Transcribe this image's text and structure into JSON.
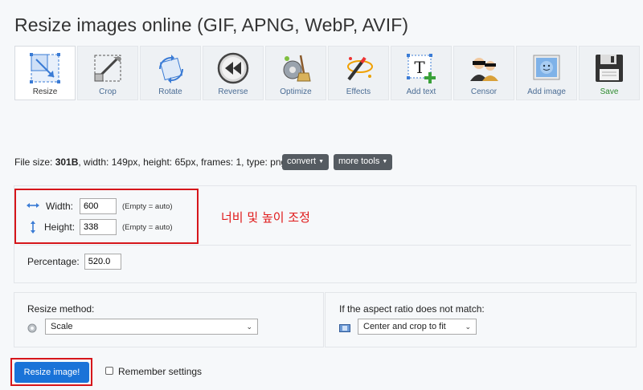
{
  "page": {
    "title": "Resize images online (GIF, APNG, WebP, AVIF)"
  },
  "toolbar": {
    "tools": [
      {
        "label": "Resize",
        "icon": "resize-icon",
        "active": true
      },
      {
        "label": "Crop",
        "icon": "crop-icon"
      },
      {
        "label": "Rotate",
        "icon": "rotate-icon"
      },
      {
        "label": "Reverse",
        "icon": "reverse-icon"
      },
      {
        "label": "Optimize",
        "icon": "optimize-icon"
      },
      {
        "label": "Effects",
        "icon": "effects-icon"
      },
      {
        "label": "Add text",
        "icon": "add-text-icon"
      },
      {
        "label": "Censor",
        "icon": "censor-icon"
      },
      {
        "label": "Add image",
        "icon": "add-image-icon"
      },
      {
        "label": "Save",
        "icon": "save-icon"
      }
    ]
  },
  "file_info": {
    "prefix": "File size:",
    "size": "301B",
    "details": ", width: 149px, height: 65px, frames: 1, type: png",
    "convert_label": "convert",
    "more_tools_label": "more tools"
  },
  "dimensions": {
    "width_label": "Width:",
    "width_value": "600",
    "height_label": "Height:",
    "height_value": "338",
    "hint": "(Empty = auto)",
    "annotation": "너비 및 높이 조정",
    "percentage_label": "Percentage:",
    "percentage_value": "520.0"
  },
  "method": {
    "resize_label": "Resize method:",
    "resize_value": "Scale",
    "aspect_label": "If the aspect ratio does not match:",
    "aspect_value": "Center and crop to fit"
  },
  "actions": {
    "resize_button": "Resize image!",
    "remember_label": "Remember settings"
  },
  "colors": {
    "accent": "#1a73d8",
    "highlight": "#d6161b",
    "save": "#2e8b2e"
  }
}
